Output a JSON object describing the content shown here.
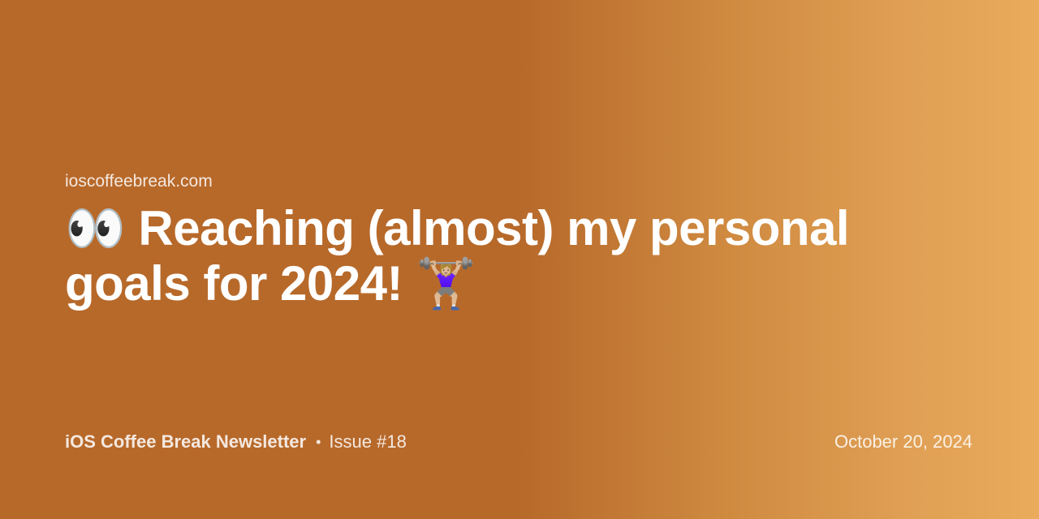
{
  "site": "ioscoffeebreak.com",
  "title": {
    "emoji_before": "👀",
    "text": "Reaching (almost) my personal goals for 2024!",
    "emoji_after": "🏋🏼‍♀️"
  },
  "footer": {
    "newsletter": "iOS Coffee Break Newsletter",
    "separator": "•",
    "issue": "Issue #18",
    "date": "October 20, 2024"
  },
  "colors": {
    "gradient_start": "#b7692a",
    "gradient_end": "#eaab5c",
    "text": "#ffffff"
  }
}
